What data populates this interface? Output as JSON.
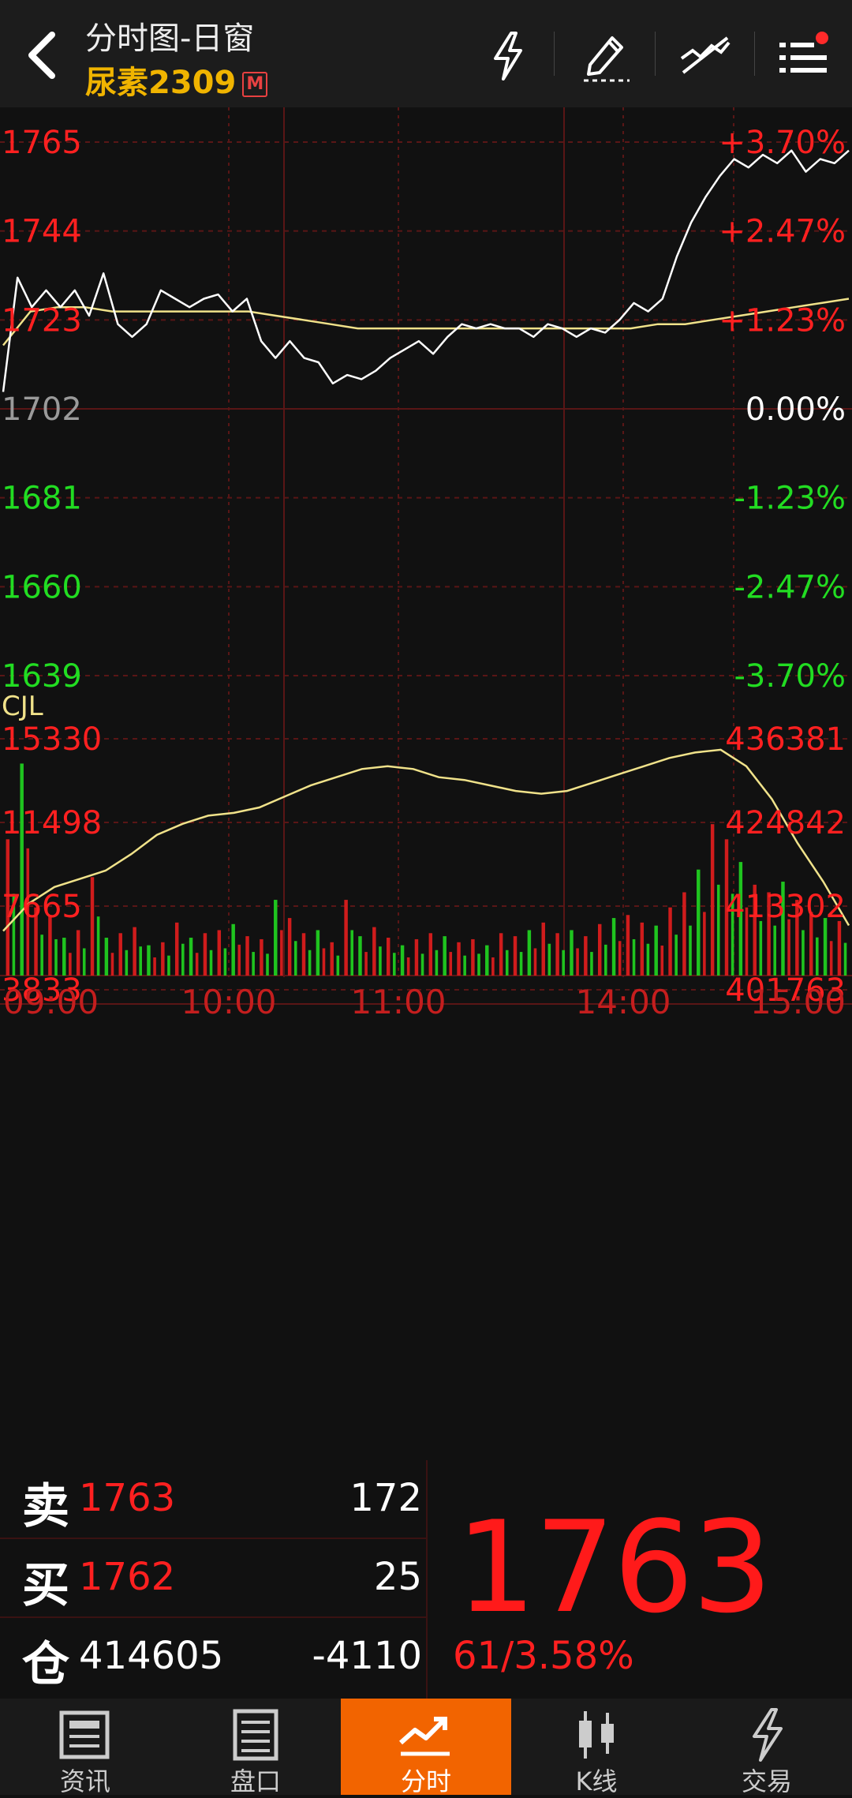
{
  "header": {
    "title": "分时图-日窗",
    "instrument": "尿素2309",
    "badge": "M",
    "icons": [
      "back-arrow-icon",
      "lightning-icon",
      "draw-pen-icon",
      "indicator-lines-icon",
      "menu-icon"
    ]
  },
  "colors": {
    "up": "#ff2020",
    "down": "#22dd22",
    "flat": "#9a9a9a",
    "price_line": "#ffffff",
    "avg_line": "#f0e28a",
    "accent": "#f26400",
    "grid": "#5a1616"
  },
  "price_axis": {
    "left": [
      "1765",
      "1744",
      "1723",
      "1702",
      "1681",
      "1660",
      "1639"
    ],
    "right": [
      "+3.70%",
      "+2.47%",
      "+1.23%",
      "0.00%",
      "-1.23%",
      "-2.47%",
      "-3.70%"
    ],
    "ref": 1702,
    "max": 1765,
    "min": 1639
  },
  "volume_axis": {
    "indicator": "CJL",
    "left": [
      "15330",
      "11498",
      "7665",
      "3833"
    ],
    "right": [
      "436381",
      "424842",
      "413302",
      "401763"
    ]
  },
  "time_axis": [
    "09:00",
    "10:00",
    "11:00",
    "14:00",
    "15:00"
  ],
  "chart_data": {
    "type": "line",
    "x_labels": [
      "09:00",
      "10:00",
      "11:00",
      "14:00",
      "15:00"
    ],
    "ylim": [
      1639,
      1765
    ],
    "series": [
      {
        "values": [
          1706,
          1733,
          1726,
          1730,
          1726,
          1730,
          1724,
          1734,
          1722,
          1719,
          1722,
          1730,
          1728,
          1726,
          1728,
          1729,
          1725,
          1728,
          1718,
          1714,
          1718,
          1714,
          1713,
          1708,
          1710,
          1709,
          1711,
          1714,
          1716,
          1718,
          1715,
          1719,
          1722,
          1721,
          1722,
          1721,
          1721,
          1719,
          1722,
          1721,
          1719,
          1721,
          1720,
          1723,
          1727,
          1725,
          1728,
          1738,
          1746,
          1752,
          1757,
          1761,
          1759,
          1762,
          1760,
          1763,
          1758,
          1761,
          1760,
          1763
        ]
      },
      {
        "values": [
          1717,
          1725,
          1726,
          1726,
          1725,
          1725,
          1725,
          1725,
          1725,
          1725,
          1724,
          1723,
          1722,
          1721,
          1721,
          1721,
          1721,
          1721,
          1721,
          1721,
          1721,
          1721,
          1721,
          1721,
          1722,
          1722,
          1723,
          1724,
          1725,
          1726,
          1727,
          1728
        ]
      }
    ],
    "volume": [
      9000,
      14000,
      4500,
      4000,
      2500,
      3000,
      6500,
      2500,
      2800,
      3200,
      2000,
      2200,
      3500,
      2500,
      2800,
      3000,
      3400,
      2600,
      2400,
      5000,
      3800,
      2800,
      3000,
      2200,
      5000,
      2600,
      3200,
      2500,
      2000,
      2400,
      2800,
      2600,
      2200,
      2400,
      2000,
      2800,
      2600,
      3000,
      3500,
      2800,
      3000,
      2600,
      3400,
      3800,
      4000,
      3500,
      3300,
      4500,
      5500,
      7000,
      10000,
      9000,
      7500,
      6000,
      5500,
      6200,
      5000,
      4200,
      3800,
      3600
    ],
    "open_interest": [
      409000,
      414000,
      417000,
      418500,
      420000,
      423000,
      426500,
      428500,
      430000,
      430500,
      431500,
      433500,
      435500,
      437000,
      438500,
      439000,
      438500,
      437000,
      436500,
      435500,
      434500,
      434000,
      434500,
      436000,
      437500,
      439000,
      440500,
      441500,
      442000,
      439000,
      433000,
      425000,
      418000,
      410000
    ]
  },
  "quote": {
    "sell_label": "卖",
    "sell_price": "1763",
    "sell_vol": "172",
    "buy_label": "买",
    "buy_price": "1762",
    "buy_vol": "25",
    "oi_label": "仓",
    "oi_value": "414605",
    "oi_change": "-4110",
    "last_price": "1763",
    "change": "61/3.58%"
  },
  "tabs": [
    {
      "label": "资讯",
      "icon": "newspaper-icon"
    },
    {
      "label": "盘口",
      "icon": "orderbook-icon"
    },
    {
      "label": "分时",
      "icon": "trend-line-icon",
      "active": true
    },
    {
      "label": "K线",
      "icon": "candlestick-icon"
    },
    {
      "label": "交易",
      "icon": "trade-lightning-icon"
    }
  ]
}
